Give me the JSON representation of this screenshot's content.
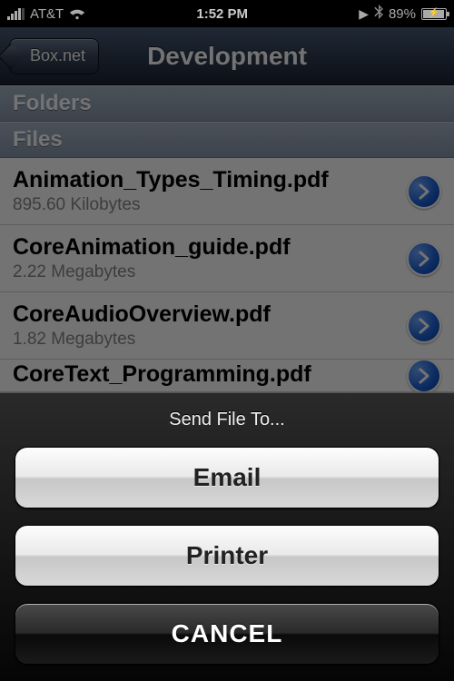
{
  "status": {
    "carrier": "AT&T",
    "time": "1:52 PM",
    "battery_pct": "89%"
  },
  "nav": {
    "back_label": "Box.net",
    "title": "Development"
  },
  "sections": {
    "folders_header": "Folders",
    "files_header": "Files"
  },
  "files": [
    {
      "name": "Animation_Types_Timing.pdf",
      "size": "895.60 Kilobytes"
    },
    {
      "name": "CoreAnimation_guide.pdf",
      "size": "2.22 Megabytes"
    },
    {
      "name": "CoreAudioOverview.pdf",
      "size": "1.82 Megabytes"
    },
    {
      "name": "CoreText_Programming.pdf",
      "size": ""
    }
  ],
  "sheet": {
    "title": "Send File To...",
    "option_email": "Email",
    "option_printer": "Printer",
    "cancel": "CANCEL"
  }
}
